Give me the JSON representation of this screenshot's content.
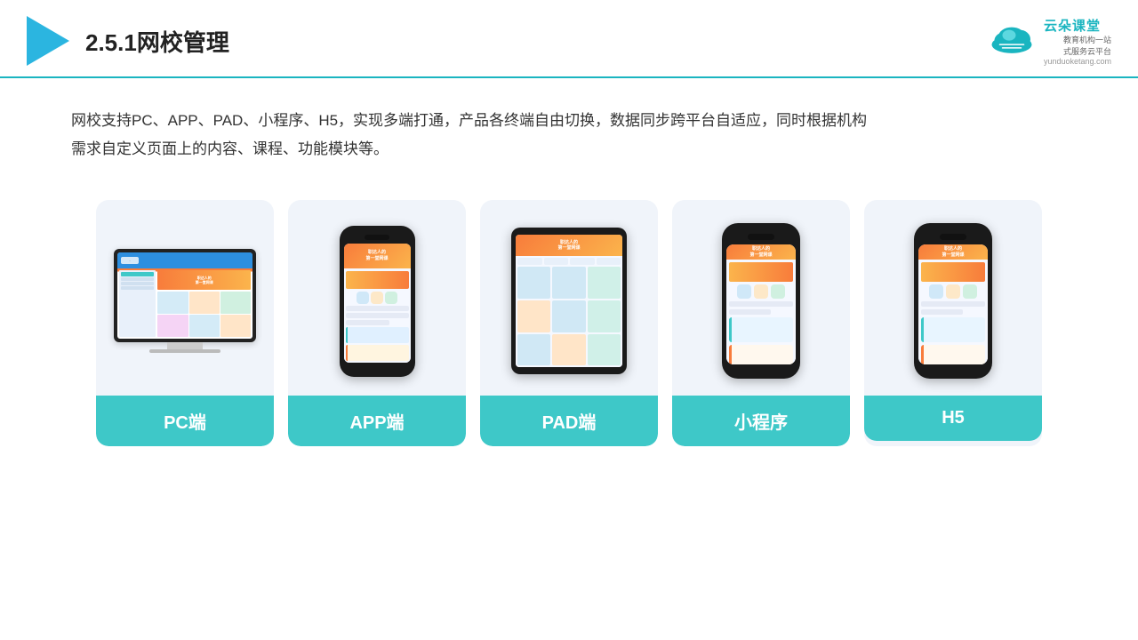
{
  "header": {
    "title": "2.5.1网校管理",
    "brand_name": "云朵课堂",
    "brand_url": "yunduoketang.com",
    "brand_tagline_line1": "教育机构一站",
    "brand_tagline_line2": "式服务云平台"
  },
  "description": {
    "text_line1": "网校支持PC、APP、PAD、小程序、H5，实现多端打通，产品各终端自由切换，数据同步跨平台自适应，同时根据机构",
    "text_line2": "需求自定义页面上的内容、课程、功能模块等。"
  },
  "cards": [
    {
      "id": "pc",
      "label": "PC端"
    },
    {
      "id": "app",
      "label": "APP端"
    },
    {
      "id": "pad",
      "label": "PAD端"
    },
    {
      "id": "mini",
      "label": "小程序"
    },
    {
      "id": "h5",
      "label": "H5"
    }
  ],
  "phone_text": {
    "top": "职达人的\n第一堂网课"
  }
}
